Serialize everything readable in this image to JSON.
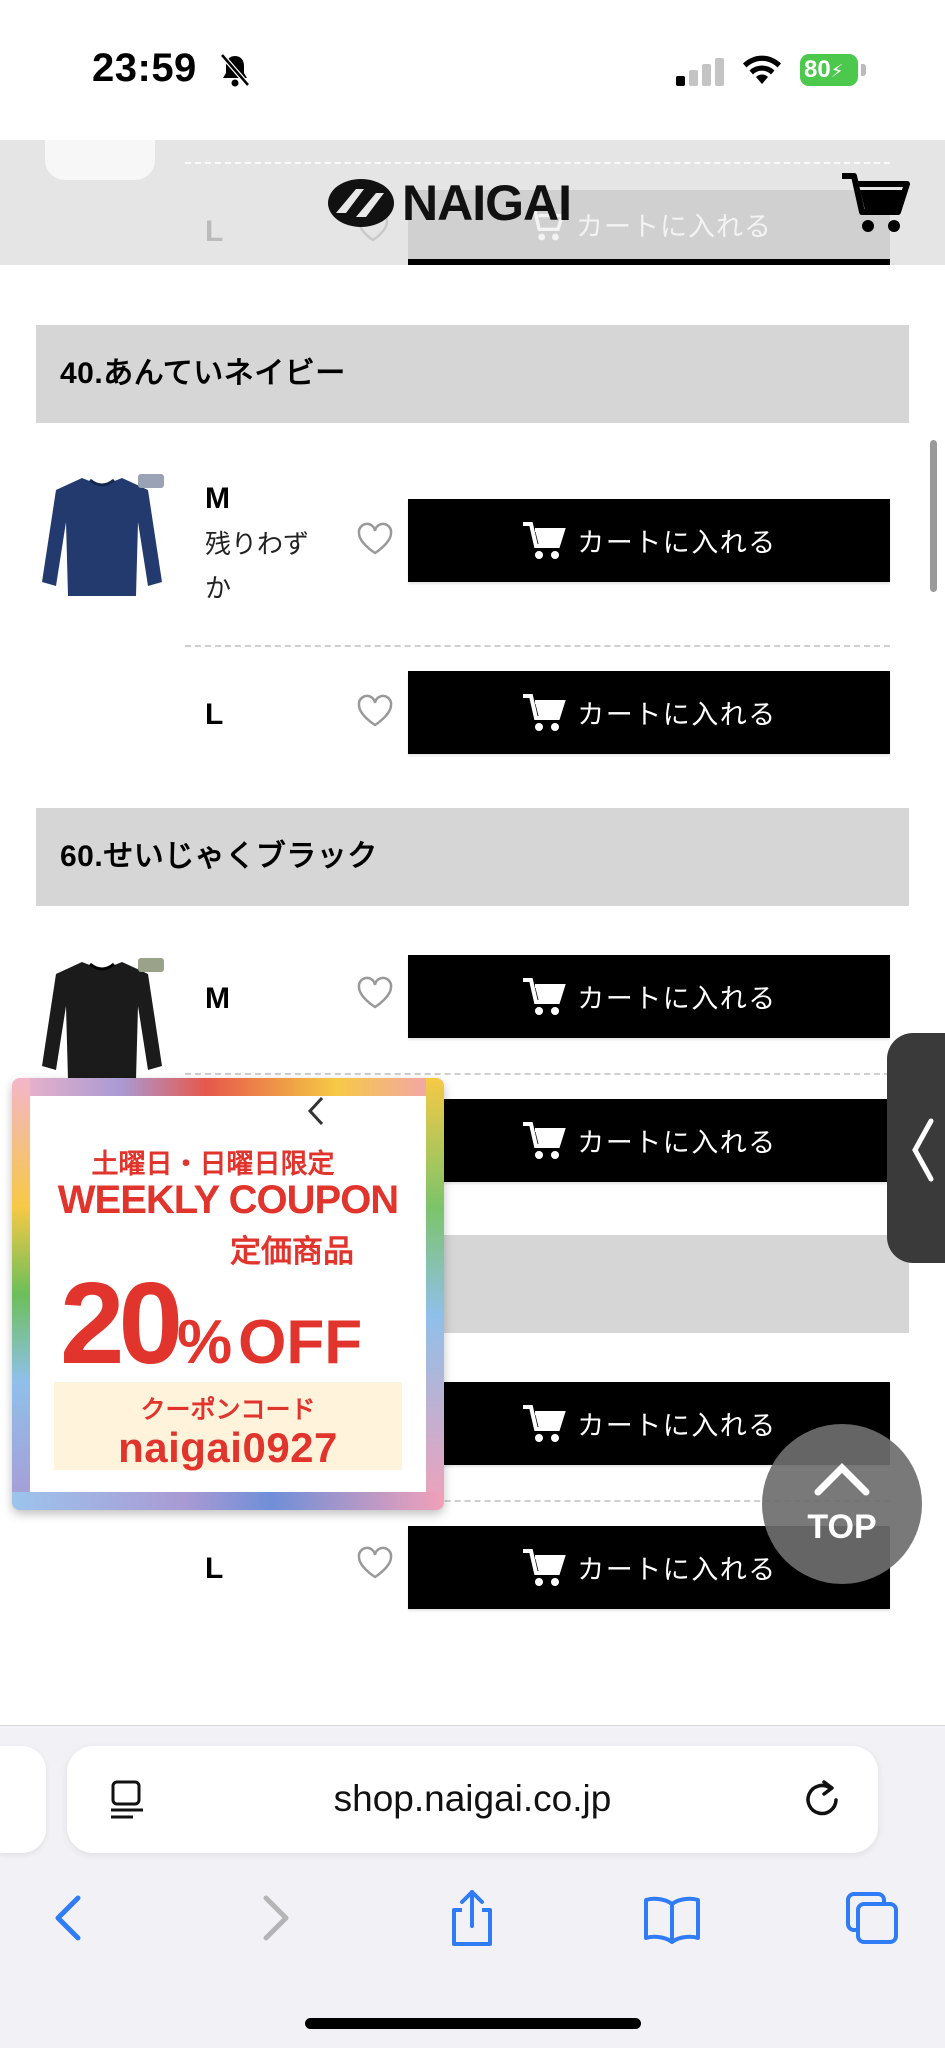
{
  "status_bar": {
    "time": "23:59",
    "battery": "80"
  },
  "header": {
    "logo_text": "NAIGAI",
    "ghost_size": "L",
    "ghost_cart_label": "カートに入れる"
  },
  "sections": [
    {
      "title": "40.あんていネイビー",
      "rows": [
        {
          "size": "M",
          "stock": "残りわずか",
          "cart_label": "カートに入れる"
        },
        {
          "size": "L",
          "stock": "",
          "cart_label": "カートに入れる"
        }
      ]
    },
    {
      "title": "60.せいじゃくブラック",
      "rows": [
        {
          "size": "M",
          "stock": "",
          "cart_label": "カートに入れる"
        },
        {
          "size": "",
          "stock": "",
          "cart_label": "カートに入れる"
        }
      ]
    },
    {
      "title": "",
      "rows": [
        {
          "size": "",
          "stock": "",
          "cart_label": "カートに入れる"
        },
        {
          "size": "L",
          "stock": "",
          "cart_label": "カートに入れる"
        }
      ]
    }
  ],
  "coupon": {
    "line1": "土曜日・日曜日限定",
    "line2": "WEEKLY COUPON",
    "line3": "定価商品",
    "discount": "20",
    "percent": "%",
    "off": "OFF",
    "code_label": "クーポンコード",
    "code": "naigai0927"
  },
  "top_button": {
    "label": "TOP"
  },
  "browser": {
    "url": "shop.naigai.co.jp"
  },
  "colors": {
    "coupon_red": "#e0342c",
    "section_bg": "#d6d6d6",
    "button_bg": "#000000"
  }
}
